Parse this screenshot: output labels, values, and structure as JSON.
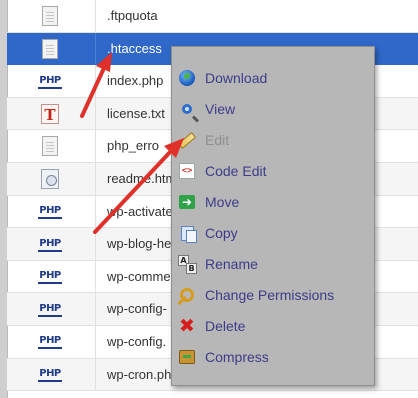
{
  "files": [
    {
      "name": ".ftpquota",
      "icon": "generic-file-icon"
    },
    {
      "name": ".htaccess",
      "icon": "generic-file-icon",
      "selected": true
    },
    {
      "name": "index.php",
      "icon": "php-file-icon"
    },
    {
      "name": "license.txt",
      "icon": "text-file-icon"
    },
    {
      "name": "php_erro",
      "icon": "generic-file-icon"
    },
    {
      "name": "readme.htm",
      "icon": "html-file-icon"
    },
    {
      "name": "wp-activate",
      "icon": "php-file-icon"
    },
    {
      "name": "wp-blog-he",
      "icon": "php-file-icon"
    },
    {
      "name": "wp-comme",
      "icon": "php-file-icon"
    },
    {
      "name": "wp-config-",
      "icon": "php-file-icon"
    },
    {
      "name": "wp-config.",
      "icon": "php-file-icon"
    },
    {
      "name": "wp-cron.php",
      "icon": "php-file-icon"
    }
  ],
  "icon_labels": {
    "php": "PHP",
    "txt": "T",
    "code": "<>",
    "rename_a": "A",
    "rename_b": "B",
    "move": "➜",
    "delete": "✖"
  },
  "context_menu": {
    "items": [
      {
        "label": "Download",
        "icon": "download-icon",
        "enabled": true
      },
      {
        "label": "View",
        "icon": "magnifier-icon",
        "enabled": true
      },
      {
        "label": "Edit",
        "icon": "pencil-icon",
        "enabled": false
      },
      {
        "label": "Code Edit",
        "icon": "code-icon",
        "enabled": true
      },
      {
        "label": "Move",
        "icon": "move-arrow-icon",
        "enabled": true
      },
      {
        "label": "Copy",
        "icon": "copy-icon",
        "enabled": true
      },
      {
        "label": "Rename",
        "icon": "rename-icon",
        "enabled": true
      },
      {
        "label": "Change Permissions",
        "icon": "key-icon",
        "enabled": true
      },
      {
        "label": "Delete",
        "icon": "delete-x-icon",
        "enabled": true
      },
      {
        "label": "Compress",
        "icon": "compress-box-icon",
        "enabled": true
      }
    ]
  },
  "colors": {
    "selection": "#2f68c8",
    "menu_background": "#b7b7b7",
    "menu_text": "#3c3c8a",
    "annotation_arrow": "#e0302a"
  }
}
